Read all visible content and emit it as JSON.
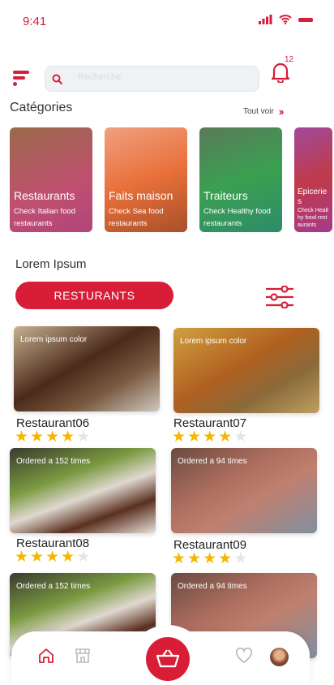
{
  "status": {
    "time": "9:41"
  },
  "header": {
    "search_placeholder": "Recherche",
    "notification_count": "12"
  },
  "categories": {
    "title": "Catégories",
    "see_all": "Tout voir",
    "items": [
      {
        "title": "Restaurants",
        "subtitle": "Check Italian food restaurants",
        "color": "#b0447a"
      },
      {
        "title": "Faits maison",
        "subtitle": "Check Sea food restaurants",
        "color": "#e9703a"
      },
      {
        "title": "Traiteurs",
        "subtitle": "Check Healthy food restaurants",
        "color": "#2e8b6a"
      },
      {
        "title": "Epiceries",
        "subtitle": "Check Healthy food restaurants",
        "color": "#a63a8a"
      }
    ]
  },
  "section": {
    "title": "Lorem Ipsum",
    "filter_button": "RESTURANTS"
  },
  "restaurants": [
    {
      "label": "Lorem ipsum color",
      "name": "Restaurant06",
      "rating": 4
    },
    {
      "label": "Lorem ipsum color",
      "name": "Restaurant07",
      "rating": 4
    },
    {
      "label": "Ordered a 152 times",
      "name": "Restaurant08",
      "rating": 4
    },
    {
      "label": "Ordered a 94 times",
      "name": "Restaurant09",
      "rating": 4
    },
    {
      "label": "Ordered a 152 times"
    },
    {
      "label": "Ordered a 94 times"
    }
  ],
  "colors": {
    "accent": "#d81e36",
    "star": "#f7b500"
  }
}
